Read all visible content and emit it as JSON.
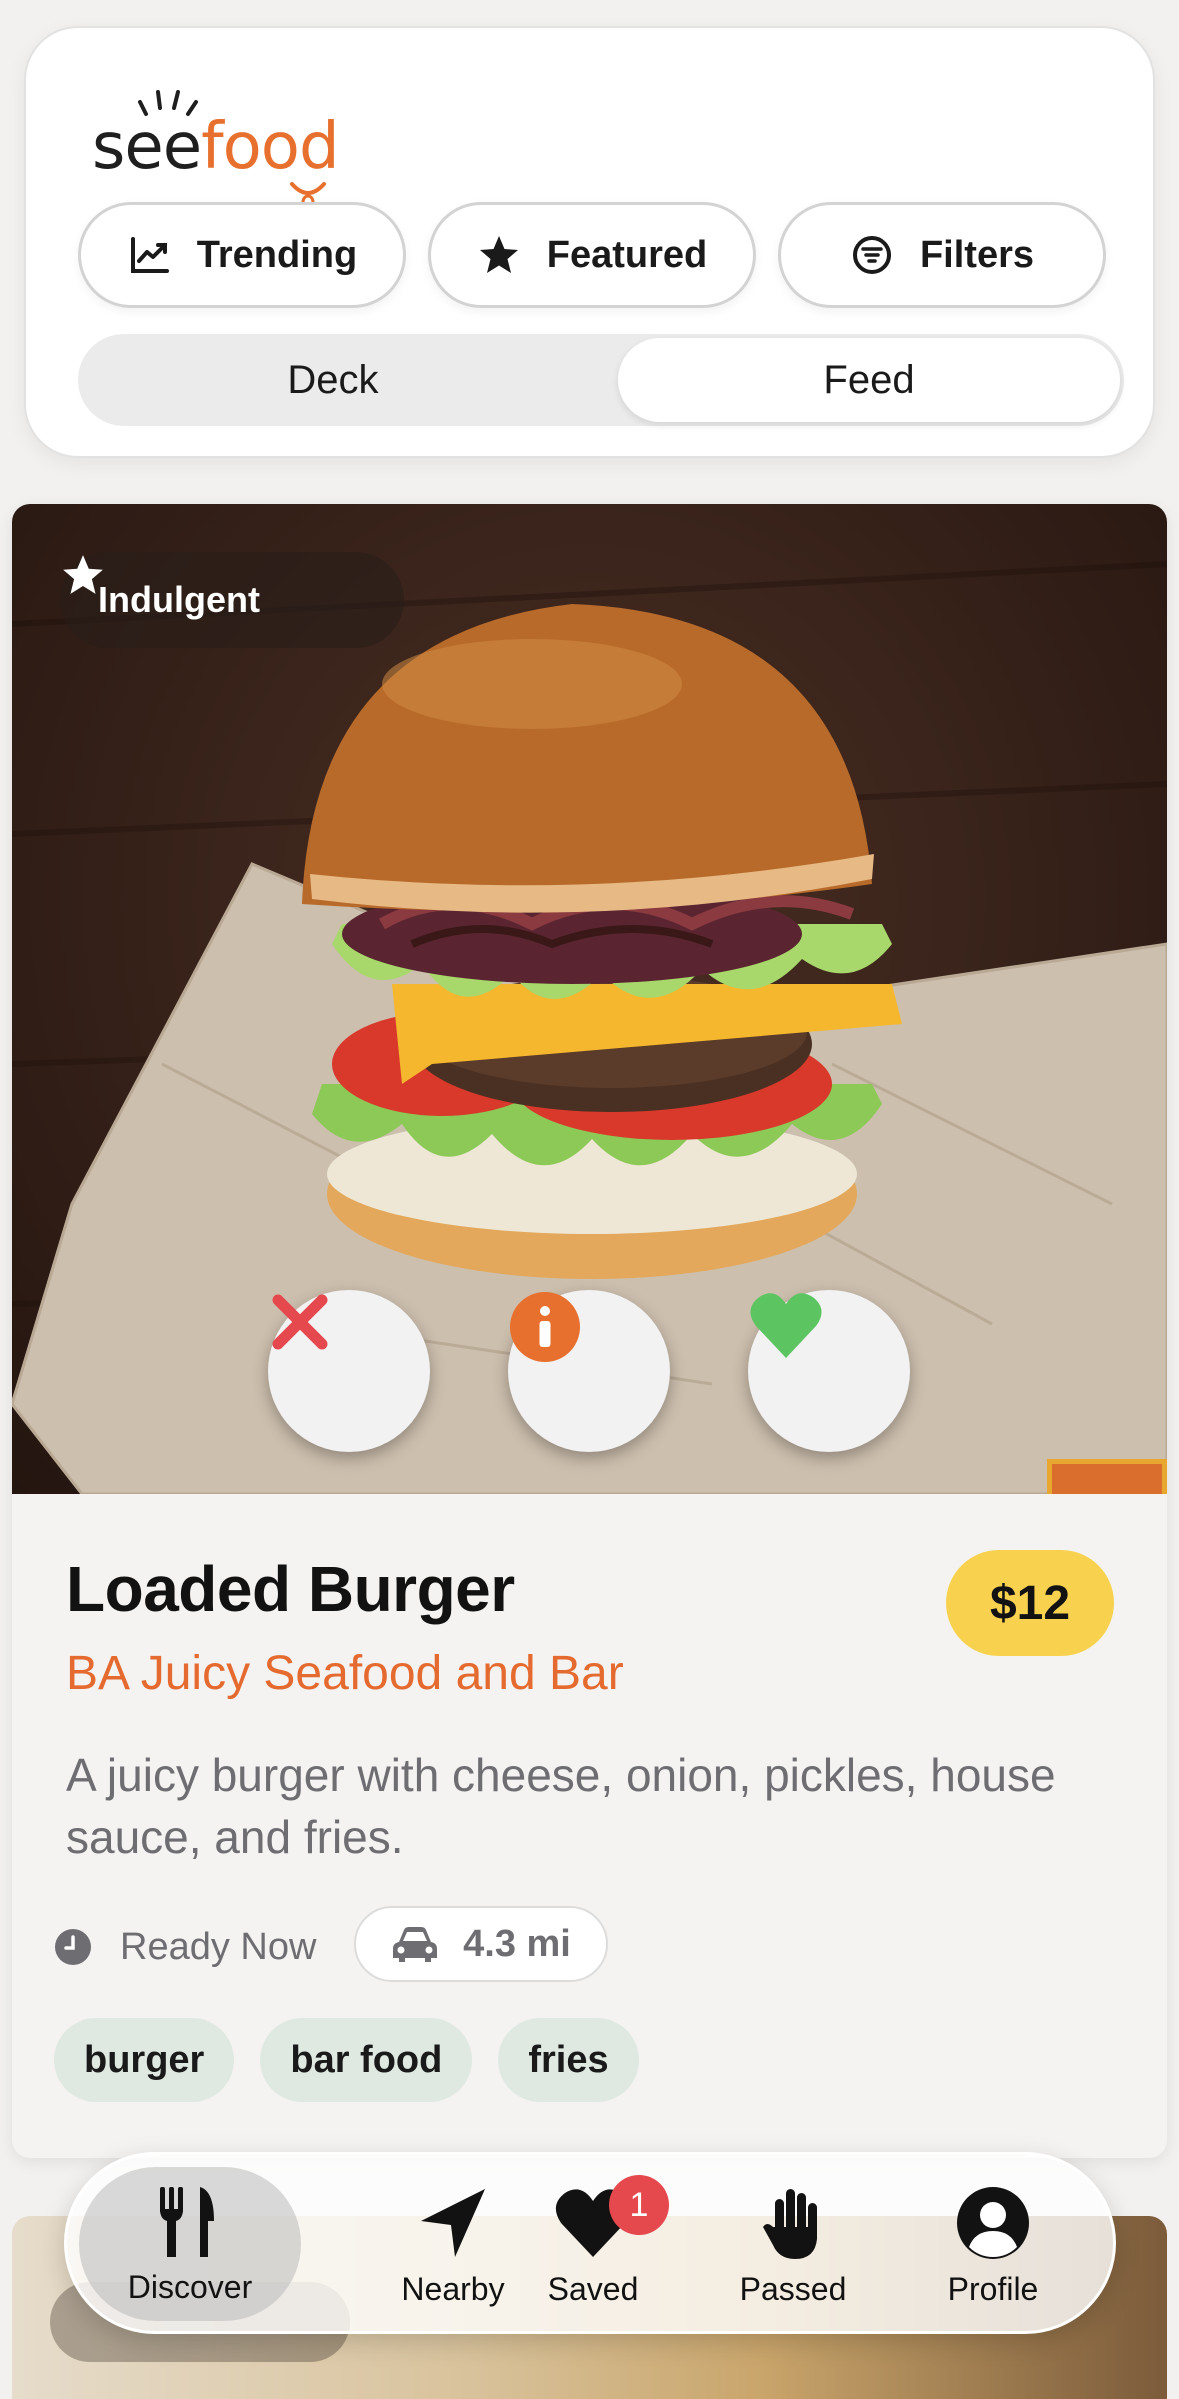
{
  "app": {
    "logo_see": "see",
    "logo_food": "food"
  },
  "header": {
    "chips": [
      {
        "label": "Trending",
        "icon": "trending-chart-icon"
      },
      {
        "label": "Featured",
        "icon": "star-icon"
      },
      {
        "label": "Filters",
        "icon": "filter-icon"
      }
    ],
    "view_toggle": {
      "options": [
        "Deck",
        "Feed"
      ],
      "selected": "Feed"
    }
  },
  "card": {
    "badge": "Indulgent",
    "title": "Loaded Burger",
    "price": "$12",
    "restaurant": "BA Juicy Seafood and Bar",
    "description": "A juicy burger with cheese, onion, pickles, house sauce, and fries.",
    "ready": "Ready Now",
    "distance": "4.3 mi",
    "tags": [
      "burger",
      "bar food",
      "fries"
    ],
    "actions": [
      "pass",
      "info",
      "like"
    ]
  },
  "colors": {
    "accent": "#e8702f",
    "price_bg": "#f8d24f",
    "pass": "#e5484d",
    "like": "#5cc561",
    "tag_bg": "#dfe9e2"
  },
  "nav": {
    "tabs": [
      {
        "label": "Discover",
        "icon": "fork-knife-icon"
      },
      {
        "label": "Nearby",
        "icon": "location-arrow-icon"
      },
      {
        "label": "Saved",
        "icon": "heart-icon",
        "badge": "1"
      },
      {
        "label": "Passed",
        "icon": "hand-icon"
      },
      {
        "label": "Profile",
        "icon": "person-icon"
      }
    ],
    "active": "Discover"
  }
}
